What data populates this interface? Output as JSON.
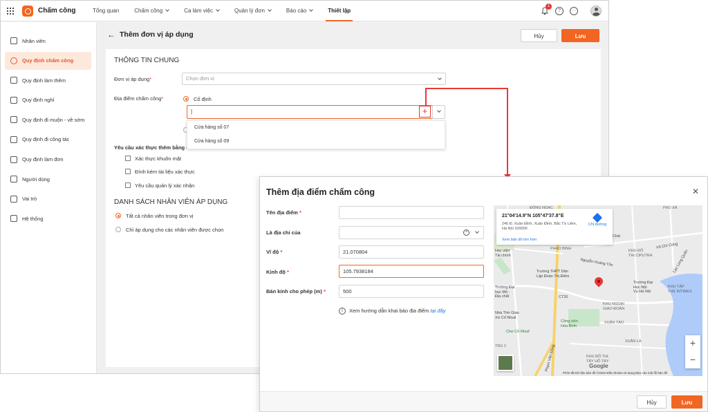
{
  "app": {
    "name": "Chấm công"
  },
  "nav": [
    {
      "label": "Tổng quan",
      "chevron": false
    },
    {
      "label": "Chấm công",
      "chevron": true
    },
    {
      "label": "Ca làm việc",
      "chevron": true
    },
    {
      "label": "Quản lý đơn",
      "chevron": true
    },
    {
      "label": "Báo cáo",
      "chevron": true
    },
    {
      "label": "Thiết lập",
      "chevron": false,
      "active": true
    }
  ],
  "notifications": {
    "count": "1"
  },
  "sidebar": [
    {
      "label": "Nhân viên",
      "icon": "users-icon"
    },
    {
      "label": "Quy định chấm công",
      "icon": "clock-icon",
      "active": true
    },
    {
      "label": "Quy định làm thêm",
      "icon": "overtime-icon"
    },
    {
      "label": "Quy định nghỉ",
      "icon": "calendar-icon"
    },
    {
      "label": "Quy định đi muộn - về sớm",
      "icon": "hourglass-icon"
    },
    {
      "label": "Quy định đi công tác",
      "icon": "briefcase-icon"
    },
    {
      "label": "Quy định làm đơn",
      "icon": "document-icon"
    },
    {
      "label": "Người dùng",
      "icon": "user-icon"
    },
    {
      "label": "Vai trò",
      "icon": "shield-icon"
    },
    {
      "label": "Hệ thống",
      "icon": "system-icon"
    }
  ],
  "page": {
    "title": "Thêm đơn vị áp dụng",
    "cancel": "Hủy",
    "save": "Lưu"
  },
  "form": {
    "general_title": "THÔNG TIN CHUNG",
    "unit_label": "Đơn vị áp dụng",
    "unit_placeholder": "Chọn đơn vị",
    "location_label": "Địa điểm chấm công",
    "fixed_label": "Cố định",
    "input_value": "|",
    "dropdown_options": [
      "Cửa hàng số 07",
      "Cửa hàng số 09"
    ],
    "verify_label": "Yêu cầu xác thực thêm bằng cá",
    "verify_options": [
      "Xác thực khuôn mặt",
      "Đính kèm tài liệu xác thực",
      "Yêu cầu quản lý xác nhận"
    ],
    "employees_title": "DANH SÁCH NHÂN VIÊN ÁP DỤNG",
    "employee_options": [
      "Tất cả nhân viên trong đơn vị",
      "Chỉ áp dụng cho các nhân viên được chọn"
    ]
  },
  "dialog": {
    "title": "Thêm địa điểm chấm công",
    "fields": {
      "name_label": "Tên địa điểm",
      "name_value": "",
      "address_of_label": "Là địa chỉ của",
      "address_of_value": "",
      "lat_label": "Vĩ độ",
      "lat_value": "21.070804",
      "lng_label": "Kinh độ",
      "lng_value": "105.7938184",
      "radius_label": "Bán kính cho phép (m)",
      "radius_value": "500"
    },
    "hint_text": "Xem hướng dẫn khai báo địa điểm",
    "hint_link": "tại đây",
    "cancel": "Hủy",
    "save": "Lưu",
    "map": {
      "coordinates": "21°04'14.9\"N 105°47'37.8\"E",
      "address": "246 Đ. Xuân Đỉnh, Xuân Đỉnh, Bắc Từ Liêm, Hà Nội 100000",
      "directions": "Chỉ đường",
      "larger_map": "Xem bản đồ lớn hơn",
      "labels": {
        "dong_ngac": "ĐÔNG NGẠC",
        "phu_xa": "PHÚ XÁ",
        "club": "Club",
        "hoc_vien_tai_chinh": "Học viện\nTài chính",
        "phao_binh": "PHÁO BINH",
        "khu_do_thi_ciputra": "KHU ĐÔ\nTHỊ CIPUTRA",
        "thpt": "Trường THPT Dân\nLập Đoàn Thị Điểm",
        "dh_mo_dia_chat": "Trường Đại\nhọc Mỏ -\nĐịa chất",
        "dai_hoc_noi_vu": "Trường Đại\nHọc Nội\nVụ Hà Nội",
        "khu_tap_the": "KHU TẬP\nTHỂ INTIMEX",
        "khu_ngoai_giao": "KHU NGOẠI\nGIAO ĐOÀN",
        "xuan_tao": "XUÂN TẢO",
        "nha_tho": "Nhà Thờ Giáo\nXứ Cổ Nhuế",
        "cong_vien": "Công viên\nHòa Bình",
        "cho_co_nhue": "Chợ Cổ Nhuế",
        "tru_2": "TRÙ 2",
        "xuan_la": "XUÂN LA",
        "khu_do_thi_tay_ho": "KHU ĐÔ THỊ\nTÂY HỒ TÂY",
        "pham_van_dong": "Phạm Văn Đồng",
        "ct20": "CT20",
        "vo_chi_cong": "Võ Chí Công",
        "lac_long_quan": "Lạc Long Quân",
        "nguyen_hoang_ton": "Nguyễn Hoàng Tôn"
      },
      "footer": "Phím tắt   Dữ liệu bản đồ ©2022   Điều khoản sử dụng   Báo cáo một lỗi bản đồ",
      "google": "Google",
      "zoom_in": "+",
      "zoom_out": "−"
    }
  },
  "colors": {
    "accent": "#f26522",
    "annotation": "#e53935",
    "link": "#1a73e8"
  }
}
